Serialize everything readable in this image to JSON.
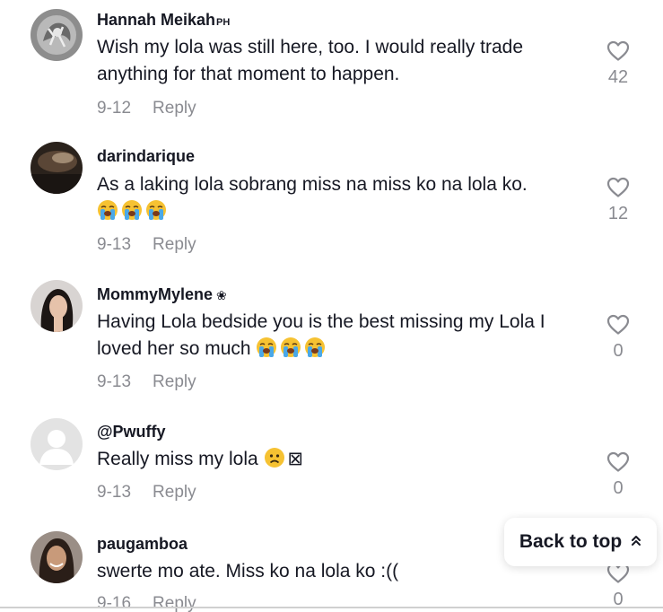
{
  "colors": {
    "primary_text": "#161823",
    "secondary_text": "#8a8b91",
    "heart_stroke": "#8a8b91"
  },
  "icons": {
    "like": "heart-outline-icon",
    "emoji_crying": "loudly-crying-face-emoji",
    "emoji_sad": "slightly-frowning-face-emoji",
    "back_to_top": "double-chevron-up-icon"
  },
  "comments": [
    {
      "username": "Hannah Meikah",
      "username_suffix": "PH",
      "text": "Wish my lola was still here, too. I would really trade anything for that moment to happen.",
      "date": "9-12",
      "reply_label": "Reply",
      "likes": "42"
    },
    {
      "username": "darindarique",
      "text": "As a laking lola sobrang miss na miss ko na lola ko.",
      "date": "9-13",
      "reply_label": "Reply",
      "likes": "12"
    },
    {
      "username": "MommyMylene",
      "username_badge": "❀",
      "text": "Having Lola bedside you is the best missing my Lola I loved her so much",
      "date": "9-13",
      "reply_label": "Reply",
      "likes": "0"
    },
    {
      "username": "@Pwuffy",
      "text": "Really miss my lola",
      "text_trailing": "⊠",
      "date": "9-13",
      "reply_label": "Reply",
      "likes": "0"
    },
    {
      "username": "paugamboa",
      "text": "swerte mo ate. Miss ko na lola ko :((",
      "date": "9-16",
      "reply_label": "Reply",
      "likes": "0"
    }
  ],
  "back_to_top": {
    "label": "Back to top",
    "chevron": "⌃"
  }
}
